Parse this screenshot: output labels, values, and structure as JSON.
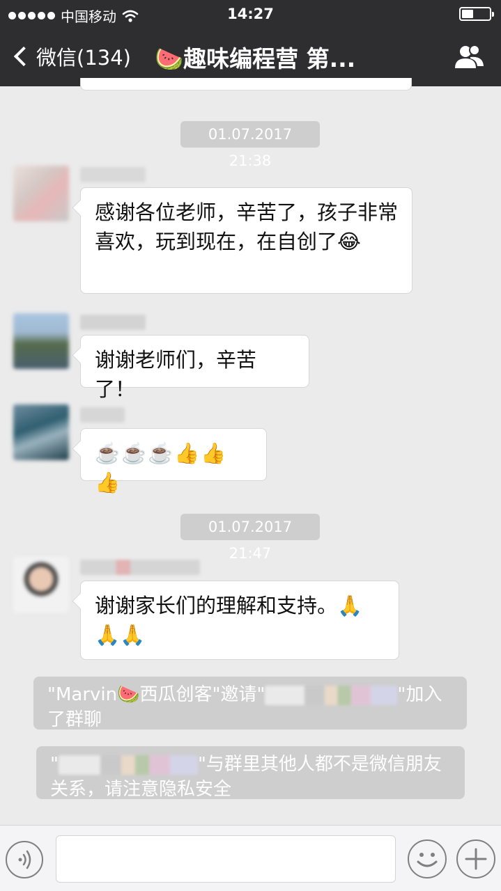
{
  "status_bar": {
    "carrier": "中国移动",
    "time": "14:27"
  },
  "nav": {
    "back_label": "微信(134)",
    "title": "🍉趣味编程营 第..."
  },
  "messages": [
    {
      "type": "time",
      "text": "01.07.2017 21:38"
    },
    {
      "type": "bubble",
      "text": "感谢各位老师，辛苦了，孩子非常喜欢，玩到现在，在自创了😂"
    },
    {
      "type": "bubble",
      "text": "谢谢老师们，辛苦了！"
    },
    {
      "type": "bubble",
      "text": "☕️☕️☕️👍👍👍"
    },
    {
      "type": "time",
      "text": "01.07.2017 21:47"
    },
    {
      "type": "bubble",
      "text": "谢谢家长们的理解和支持。🙏🙏🙏"
    }
  ],
  "system_notices": [
    {
      "before": "\"Marvin🍉西瓜创客\"邀请\"",
      "after": "\"加入了群聊"
    },
    {
      "before": "\"",
      "after": "\"与群里其他人都不是微信朋友关系，请注意隐私安全"
    }
  ],
  "colors": {
    "nav_bg": "#2e2e30",
    "chat_bg": "#ebebeb",
    "pill_bg": "#cecece",
    "bubble_bg": "#ffffff"
  }
}
